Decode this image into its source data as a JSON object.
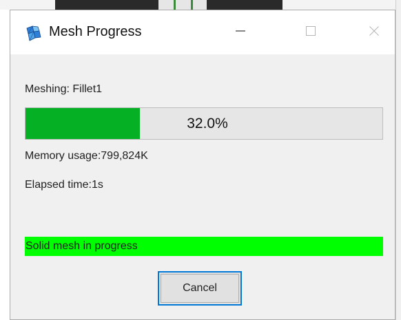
{
  "window": {
    "title": "Mesh Progress",
    "icon": "mesh-app-icon",
    "controls": {
      "minimize_icon": "minimize-icon",
      "maximize_icon": "maximize-icon",
      "close_icon": "close-icon"
    }
  },
  "meshing": {
    "label": "Meshing: Fillet1"
  },
  "progress": {
    "value_percent": 32.0,
    "text": "32.0%",
    "fill_color": "#06b025"
  },
  "stats": {
    "memory": "Memory usage:799,824K",
    "elapsed": "Elapsed time:1s"
  },
  "status": {
    "text": "Solid mesh in progress",
    "color": "#00ff00"
  },
  "actions": {
    "cancel_label": "Cancel",
    "accent_color": "#0078d7"
  }
}
